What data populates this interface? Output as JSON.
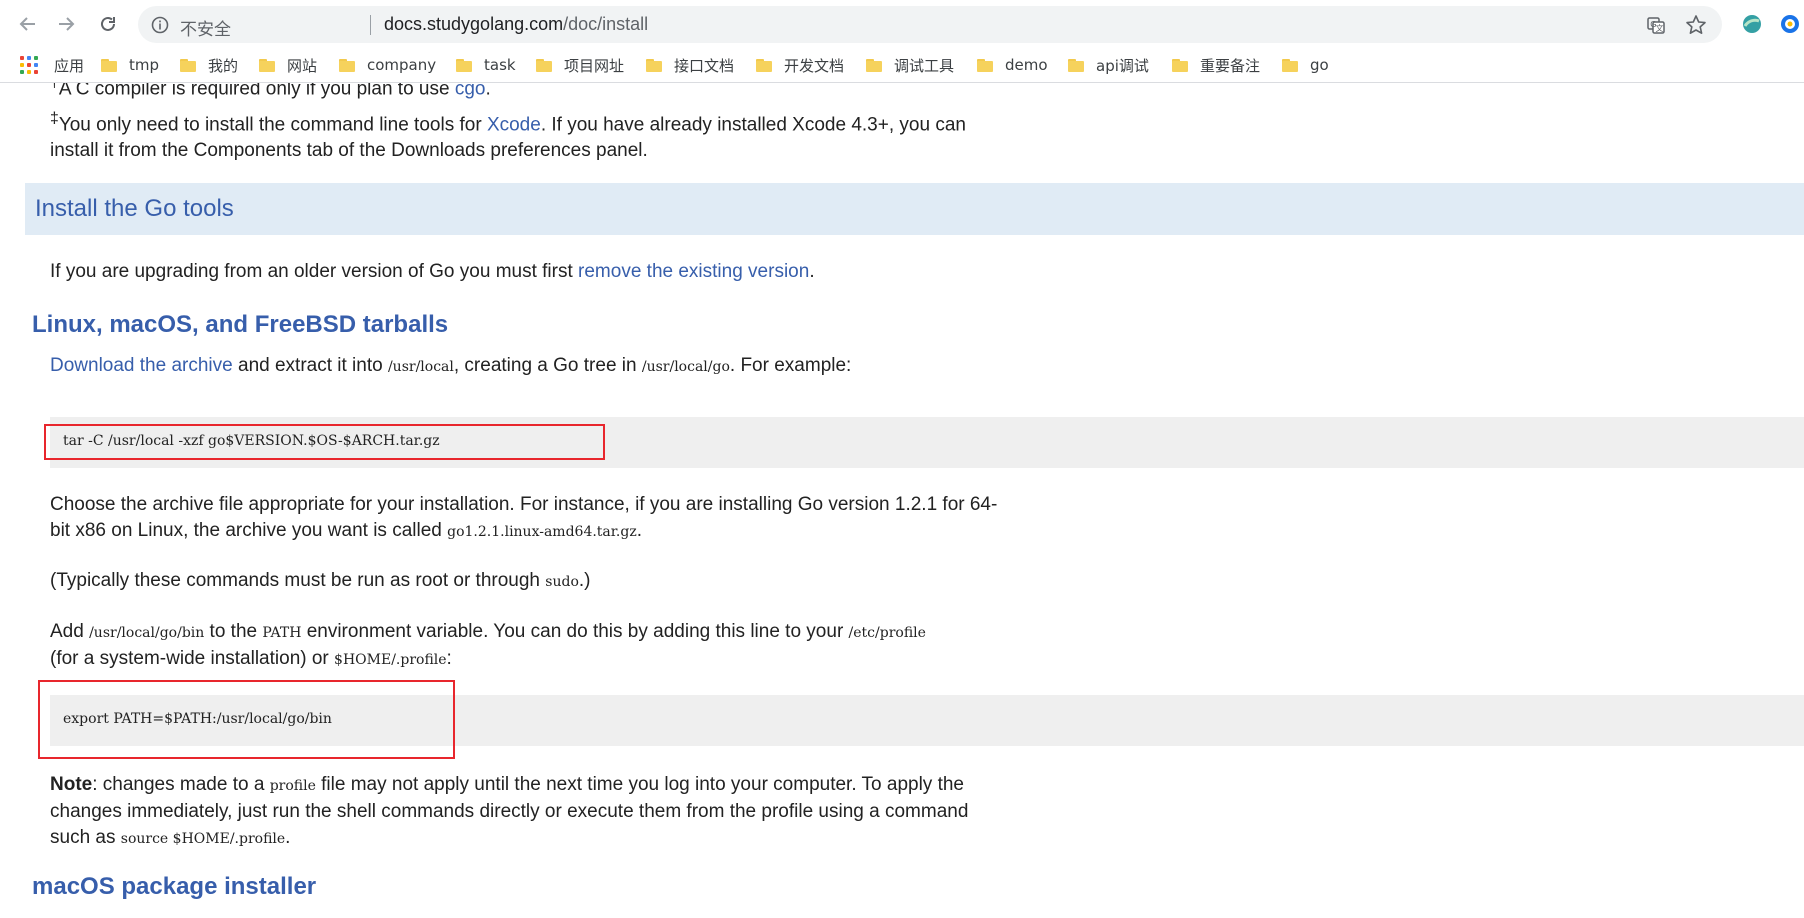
{
  "browser": {
    "security_label": "不安全",
    "url_host": "docs.studygolang.com",
    "url_path": "/doc/install"
  },
  "bookmarks": [
    {
      "label": "应用",
      "type": "apps"
    },
    {
      "label": "tmp"
    },
    {
      "label": "我的"
    },
    {
      "label": "网站"
    },
    {
      "label": "company"
    },
    {
      "label": "task"
    },
    {
      "label": "项目网址"
    },
    {
      "label": "接口文档"
    },
    {
      "label": "开发文档"
    },
    {
      "label": "调试工具"
    },
    {
      "label": "demo"
    },
    {
      "label": "api调试"
    },
    {
      "label": "重要备注"
    },
    {
      "label": "go"
    }
  ],
  "page": {
    "footnote1": {
      "mark": "†",
      "text_before": "A C compiler is required only if you plan to use ",
      "link": "cgo",
      "text_after": "."
    },
    "footnote2": {
      "mark": "‡",
      "text_before": "You only need to install the command line tools for ",
      "link": "Xcode",
      "text_after": ". If you have already installed Xcode 4.3+, you can",
      "line2": "install it from the Components tab of the Downloads preferences panel."
    },
    "install_heading": "Install the Go tools",
    "upgrade": {
      "text_before": "If you are upgrading from an older version of Go you must first ",
      "link": "remove the existing version",
      "text_after": "."
    },
    "tarballs_heading": "Linux, macOS, and FreeBSD tarballs",
    "download": {
      "link": "Download the archive",
      "t1": " and extract it into ",
      "c1": "/usr/local",
      "t2": ", creating a Go tree in ",
      "c2": "/usr/local/go",
      "t3": ". For example:"
    },
    "cmd1": "tar -C /usr/local -xzf go$VERSION.$OS-$ARCH.tar.gz",
    "choose": {
      "line1": "Choose the archive file appropriate for your installation. For instance, if you are installing Go version 1.2.1 for 64-",
      "line2_before": "bit x86 on Linux, the archive you want is called ",
      "code": "go1.2.1.linux-amd64.tar.gz",
      "line2_after": "."
    },
    "typically": {
      "before": "(Typically these commands must be run as root or through ",
      "code": "sudo",
      "after": ".)"
    },
    "add": {
      "t1": "Add ",
      "c1": "/usr/local/go/bin",
      "t2": " to the ",
      "c2": "PATH",
      "t3": " environment variable. You can do this by adding this line to your ",
      "c3": "/etc/profile",
      "l2_t1": "(for a system-wide installation) or ",
      "l2_c1": "$HOME/.profile",
      "l2_t2": ":"
    },
    "cmd2": "export PATH=$PATH:/usr/local/go/bin",
    "note": {
      "bold": "Note",
      "t1": ": changes made to a ",
      "c1": "profile",
      "t2": " file may not apply until the next time you log into your computer. To apply the",
      "line2": "changes immediately, just run the shell commands directly or execute them from the profile using a command",
      "l3_t1": "such as ",
      "l3_c1": "source $HOME/.profile",
      "l3_t2": "."
    },
    "macos_heading": "macOS package installer"
  },
  "colors": {
    "link": "#375eab",
    "highlight": "#e8262d",
    "section_bg": "#e0ebf5",
    "code_bg": "#efefef"
  },
  "icons": [
    "back-arrow-icon",
    "forward-arrow-icon",
    "reload-icon",
    "info-icon",
    "translate-icon",
    "star-icon",
    "apps-grid-icon",
    "folder-icon"
  ]
}
